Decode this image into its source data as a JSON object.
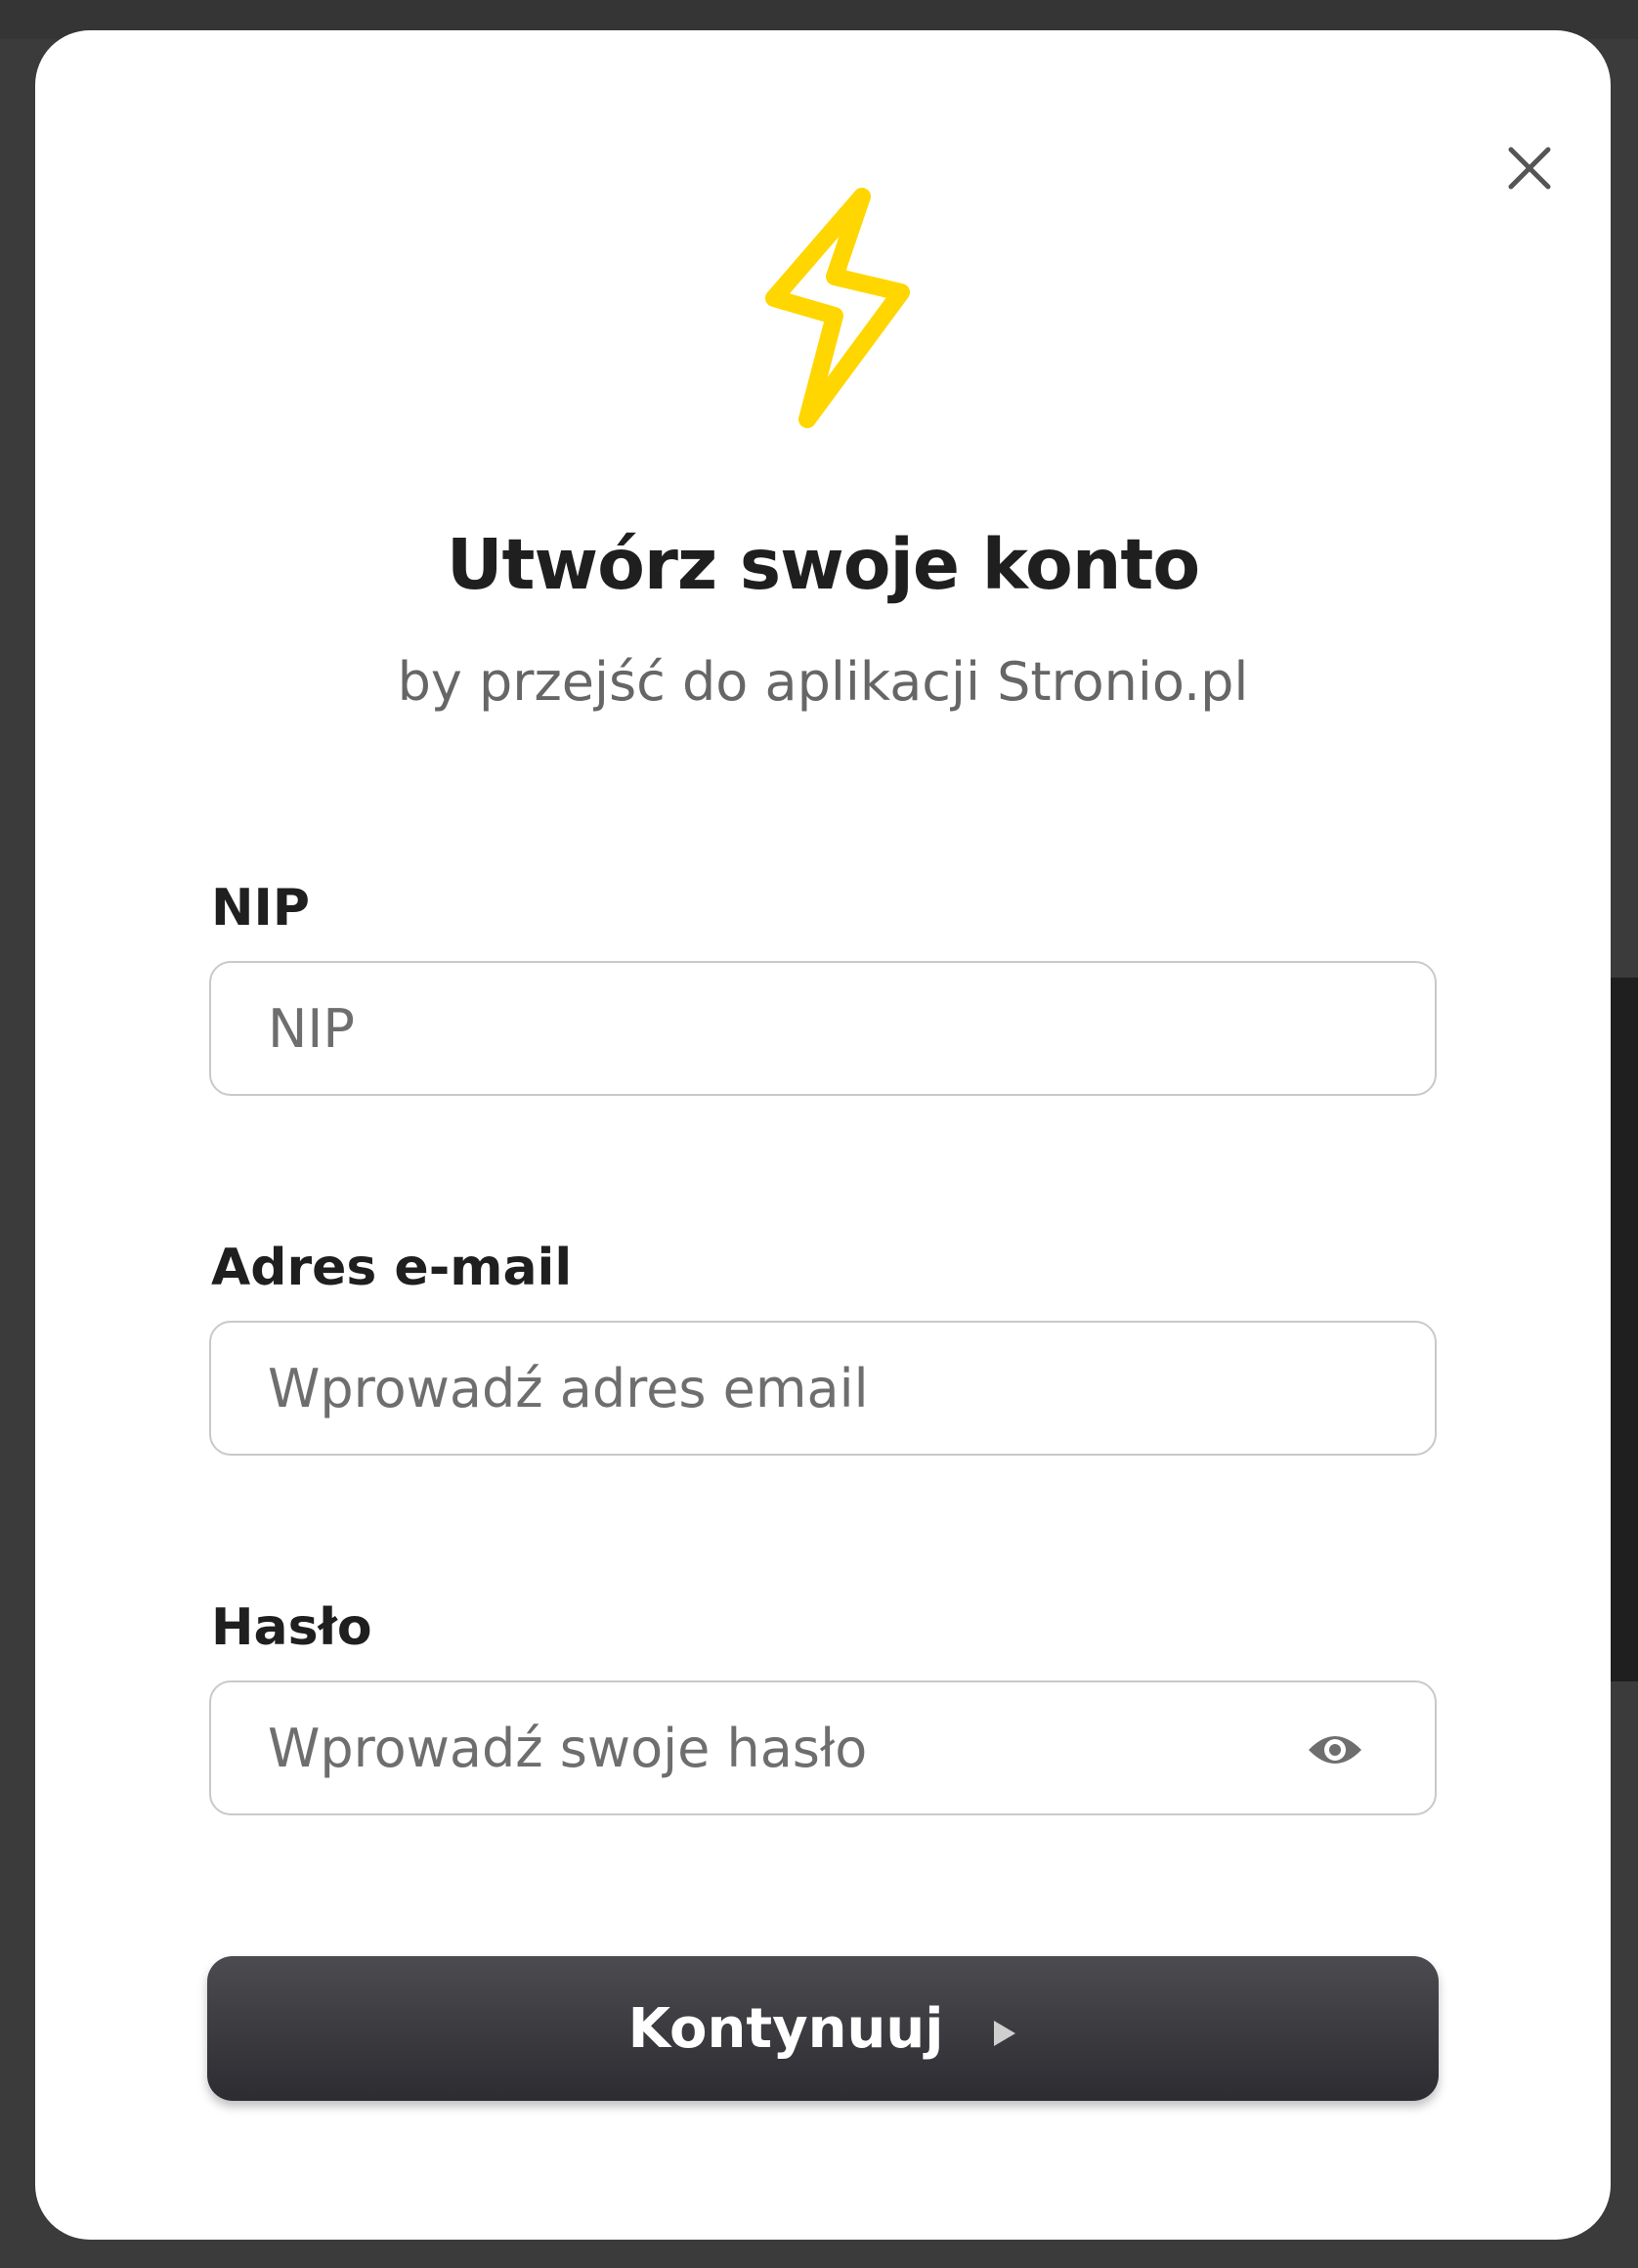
{
  "modal": {
    "title": "Utwórz swoje konto",
    "subtitle": "by przejść do aplikacji Stronio.pl",
    "icons": {
      "close": "close-icon",
      "logo": "lightning-bolt-icon",
      "password_toggle": "eye-icon",
      "continue": "play-arrow-icon"
    },
    "colors": {
      "accent": "#FFD600",
      "button": "#3a3a3f"
    },
    "fields": {
      "nip": {
        "label": "NIP",
        "placeholder": "NIP",
        "value": ""
      },
      "email": {
        "label": "Adres e-mail",
        "placeholder": "Wprowadź adres email",
        "value": ""
      },
      "password": {
        "label": "Hasło",
        "placeholder": "Wprowadź swoje hasło",
        "value": ""
      }
    },
    "continue_label": "Kontynuuj"
  }
}
